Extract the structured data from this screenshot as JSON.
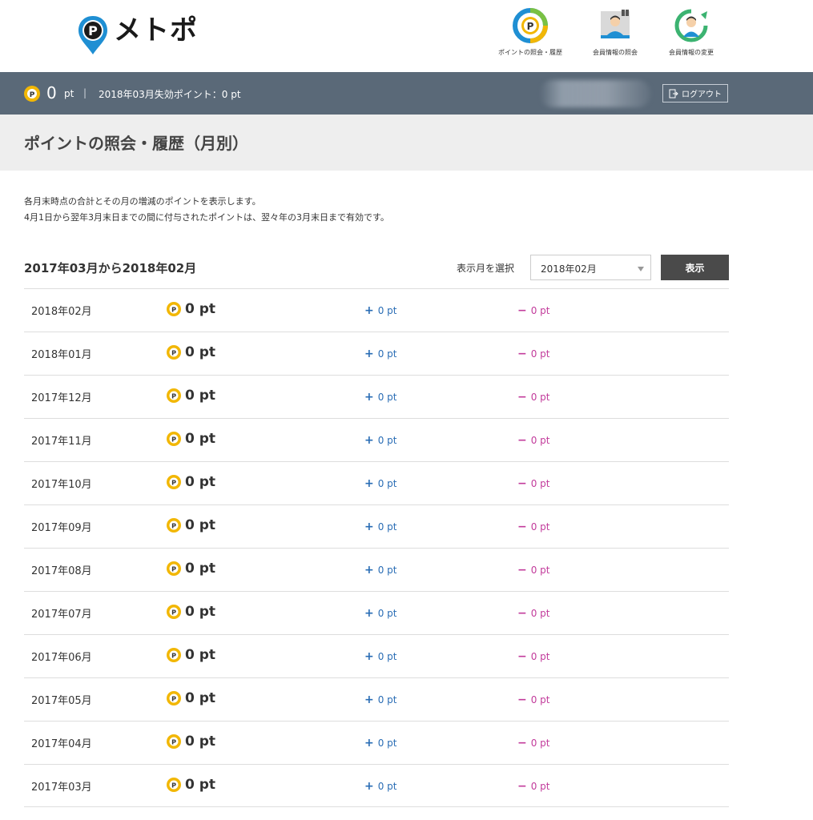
{
  "header": {
    "logo_text": "メトポ",
    "nav": [
      {
        "label": "ポイントの照会・履歴",
        "icon": "point-history-icon"
      },
      {
        "label": "会員情報の照会",
        "icon": "member-info-icon"
      },
      {
        "label": "会員情報の変更",
        "icon": "member-edit-icon"
      }
    ]
  },
  "status": {
    "points": "0",
    "unit": "pt",
    "separator": "|",
    "expire_text": "2018年03月失効ポイント：0 pt",
    "logout_label": "ログアウト"
  },
  "page": {
    "title": "ポイントの照会・履歴（月別）",
    "description_lines": [
      "各月末時点の合計とその月の増減のポイントを表示します。",
      "4月1日から翌年3月末日までの間に付与されたポイントは、翌々年の3月末日まで有効です。"
    ],
    "range_title": "2017年03月から2018年02月",
    "select_label": "表示月を選択",
    "select_value": "2018年02月",
    "show_button": "表示"
  },
  "rows": [
    {
      "month": "2018年02月",
      "total": "0 pt",
      "plus": "0 pt",
      "minus": "0 pt"
    },
    {
      "month": "2018年01月",
      "total": "0 pt",
      "plus": "0 pt",
      "minus": "0 pt"
    },
    {
      "month": "2017年12月",
      "total": "0 pt",
      "plus": "0 pt",
      "minus": "0 pt"
    },
    {
      "month": "2017年11月",
      "total": "0 pt",
      "plus": "0 pt",
      "minus": "0 pt"
    },
    {
      "month": "2017年10月",
      "total": "0 pt",
      "plus": "0 pt",
      "minus": "0 pt"
    },
    {
      "month": "2017年09月",
      "total": "0 pt",
      "plus": "0 pt",
      "minus": "0 pt"
    },
    {
      "month": "2017年08月",
      "total": "0 pt",
      "plus": "0 pt",
      "minus": "0 pt"
    },
    {
      "month": "2017年07月",
      "total": "0 pt",
      "plus": "0 pt",
      "minus": "0 pt"
    },
    {
      "month": "2017年06月",
      "total": "0 pt",
      "plus": "0 pt",
      "minus": "0 pt"
    },
    {
      "month": "2017年05月",
      "total": "0 pt",
      "plus": "0 pt",
      "minus": "0 pt"
    },
    {
      "month": "2017年04月",
      "total": "0 pt",
      "plus": "0 pt",
      "minus": "0 pt"
    },
    {
      "month": "2017年03月",
      "total": "0 pt",
      "plus": "0 pt",
      "minus": "0 pt"
    }
  ],
  "signs": {
    "plus": "+",
    "minus": "−"
  },
  "colors": {
    "statusbar": "#5a6978",
    "coin": "#f2b705",
    "plus": "#2a6db5",
    "minus": "#c23b9b",
    "brand_blue": "#1f8fd3"
  }
}
